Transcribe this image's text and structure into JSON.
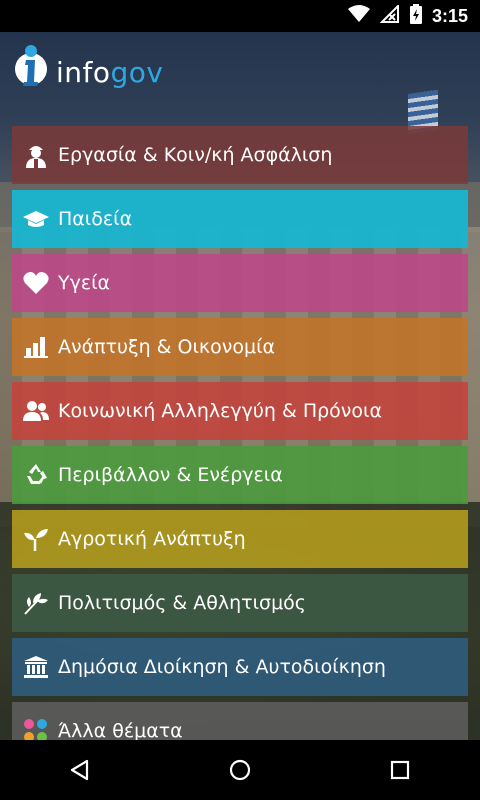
{
  "status_bar": {
    "time": "3:15"
  },
  "header": {
    "logo_prefix": "info",
    "logo_suffix": "gov"
  },
  "colors": {
    "accent": "#2ea8e0",
    "items": [
      "#7b3a38",
      "#19b5d0",
      "#c0458a",
      "#c2742a",
      "#c4433c",
      "#4c9a3e",
      "#b39b1d",
      "#3c5a44",
      "#2f5c7c",
      "#5f5f5f"
    ]
  },
  "menu": {
    "items": [
      {
        "label": "Εργασία & Κοιν/κή Ασφάλιση",
        "icon": "worker-icon"
      },
      {
        "label": "Παιδεία",
        "icon": "graduation-cap-icon"
      },
      {
        "label": "Υγεία",
        "icon": "heart-icon"
      },
      {
        "label": "Ανάπτυξη & Οικονομία",
        "icon": "bar-chart-icon"
      },
      {
        "label": "Κοινωνική Αλληλεγγύη & Πρόνοια",
        "icon": "people-icon"
      },
      {
        "label": "Περιβάλλον & Ενέργεια",
        "icon": "recycle-icon"
      },
      {
        "label": "Αγροτική Ανάπτυξη",
        "icon": "sprout-icon"
      },
      {
        "label": "Πολιτισμός & Αθλητισμός",
        "icon": "leaf-icon"
      },
      {
        "label": "Δημόσια Διοίκηση & Αυτοδιοίκηση",
        "icon": "institution-icon"
      },
      {
        "label": "Άλλα θέματα",
        "icon": "dots-icon"
      }
    ]
  }
}
